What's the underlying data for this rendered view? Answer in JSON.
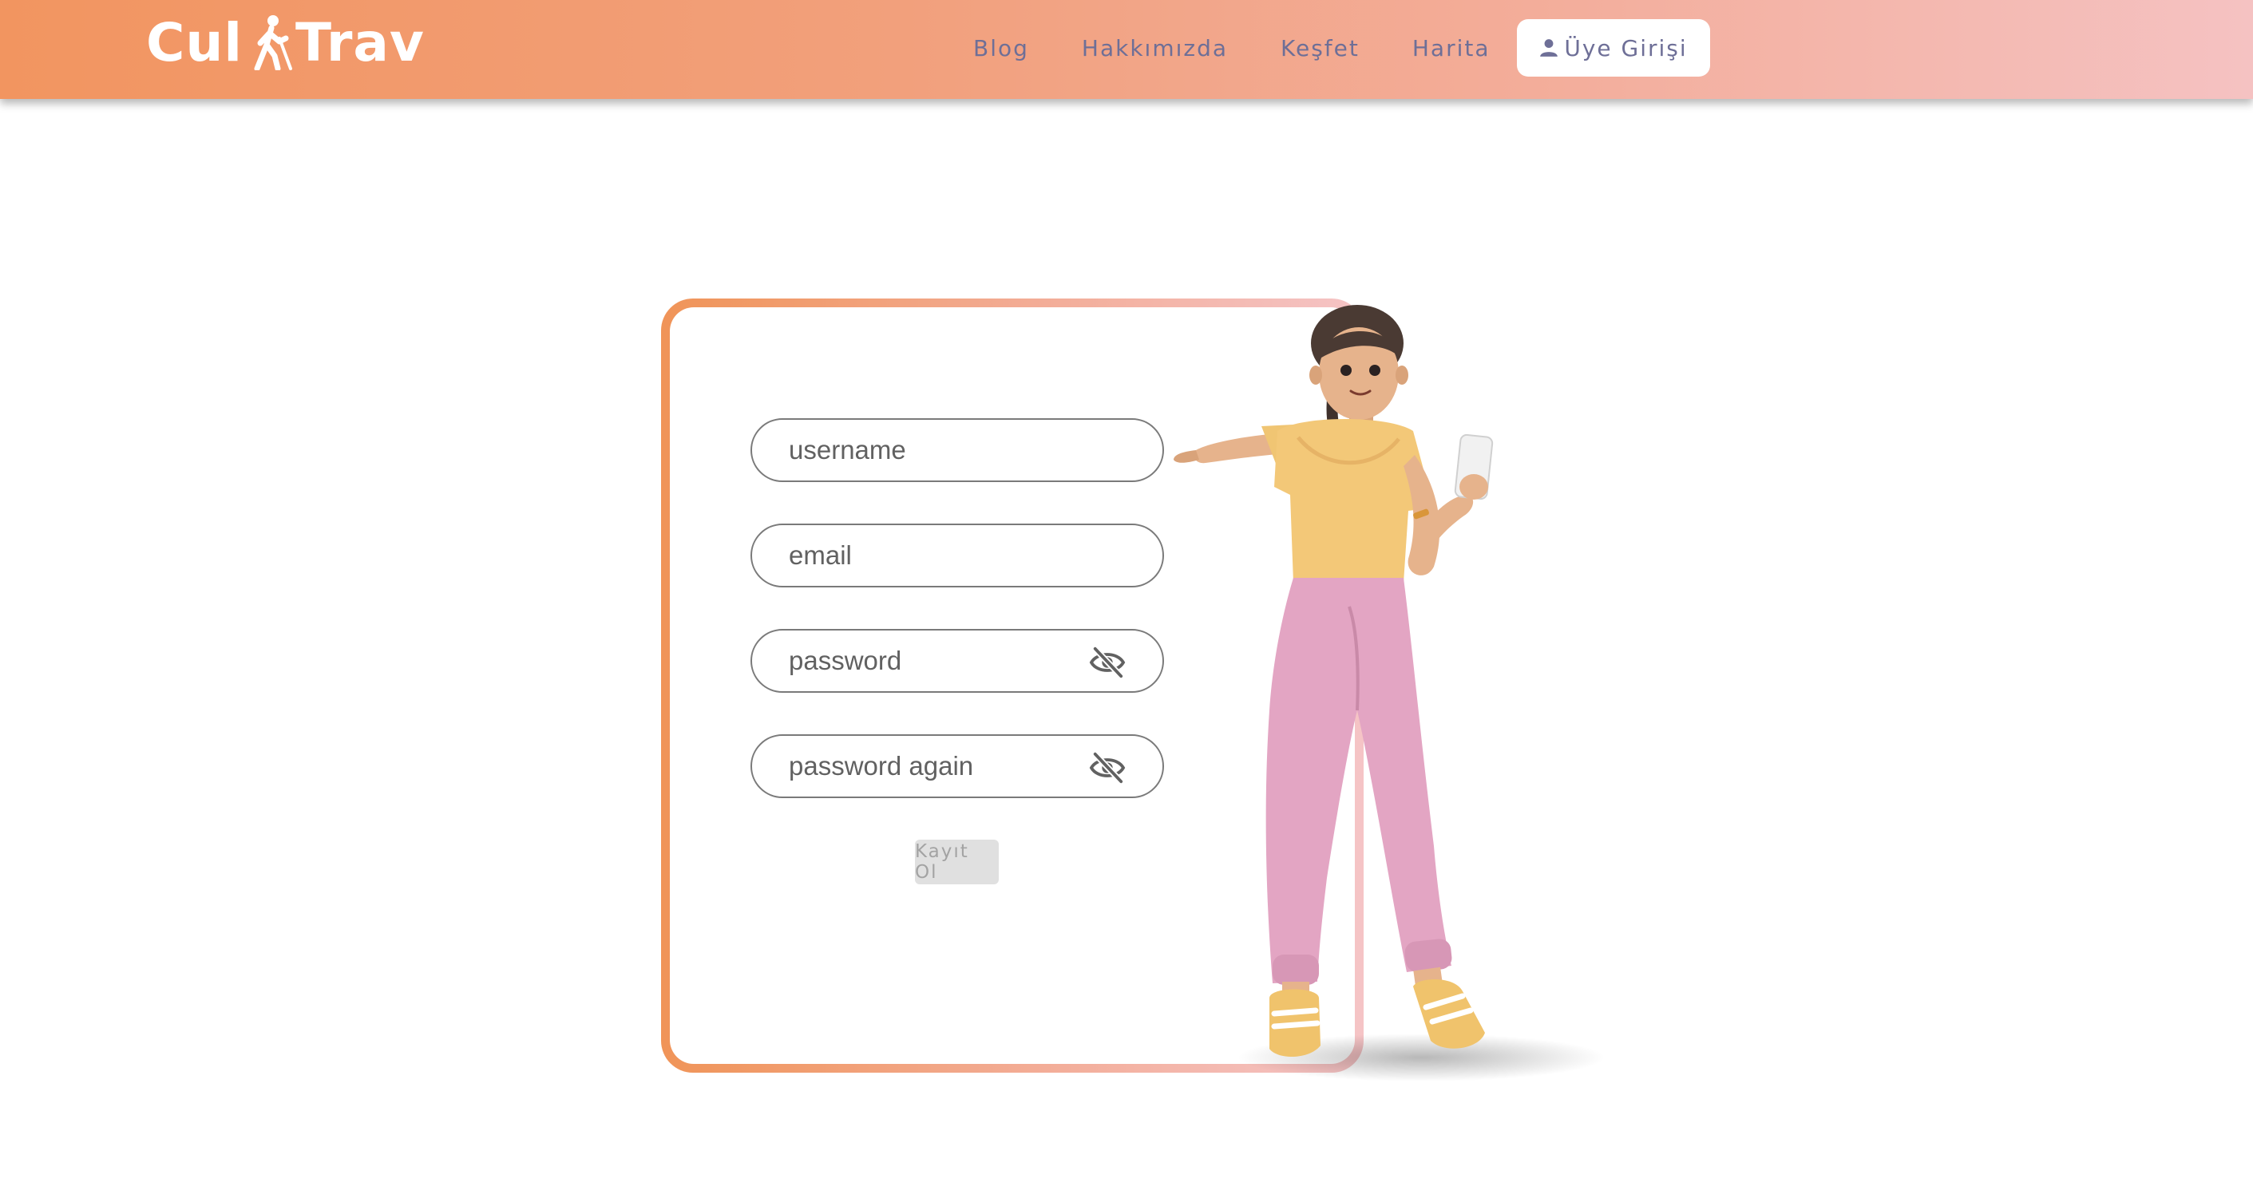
{
  "header": {
    "logo_text_left": "Cul",
    "logo_text_right": "Trav",
    "nav": [
      "Blog",
      "Hakkımızda",
      "Keşfet",
      "Harita"
    ],
    "login_label": "Üye Girişi"
  },
  "form": {
    "username_placeholder": "username",
    "email_placeholder": "email",
    "password_placeholder": "password",
    "password_again_placeholder": "password again",
    "submit_label": "Kayıt Ol"
  },
  "icons": {
    "logo": "walking-person-icon",
    "login": "person-icon",
    "password_toggle": "eye-off-icon"
  },
  "colors": {
    "header_gradient_start": "#f29560",
    "header_gradient_end": "#f5c2c2",
    "nav_text": "#6e6f97",
    "card_border_start": "#f09458",
    "card_border_end": "#f5c4c6",
    "submit_bg": "#e0e0e0"
  }
}
